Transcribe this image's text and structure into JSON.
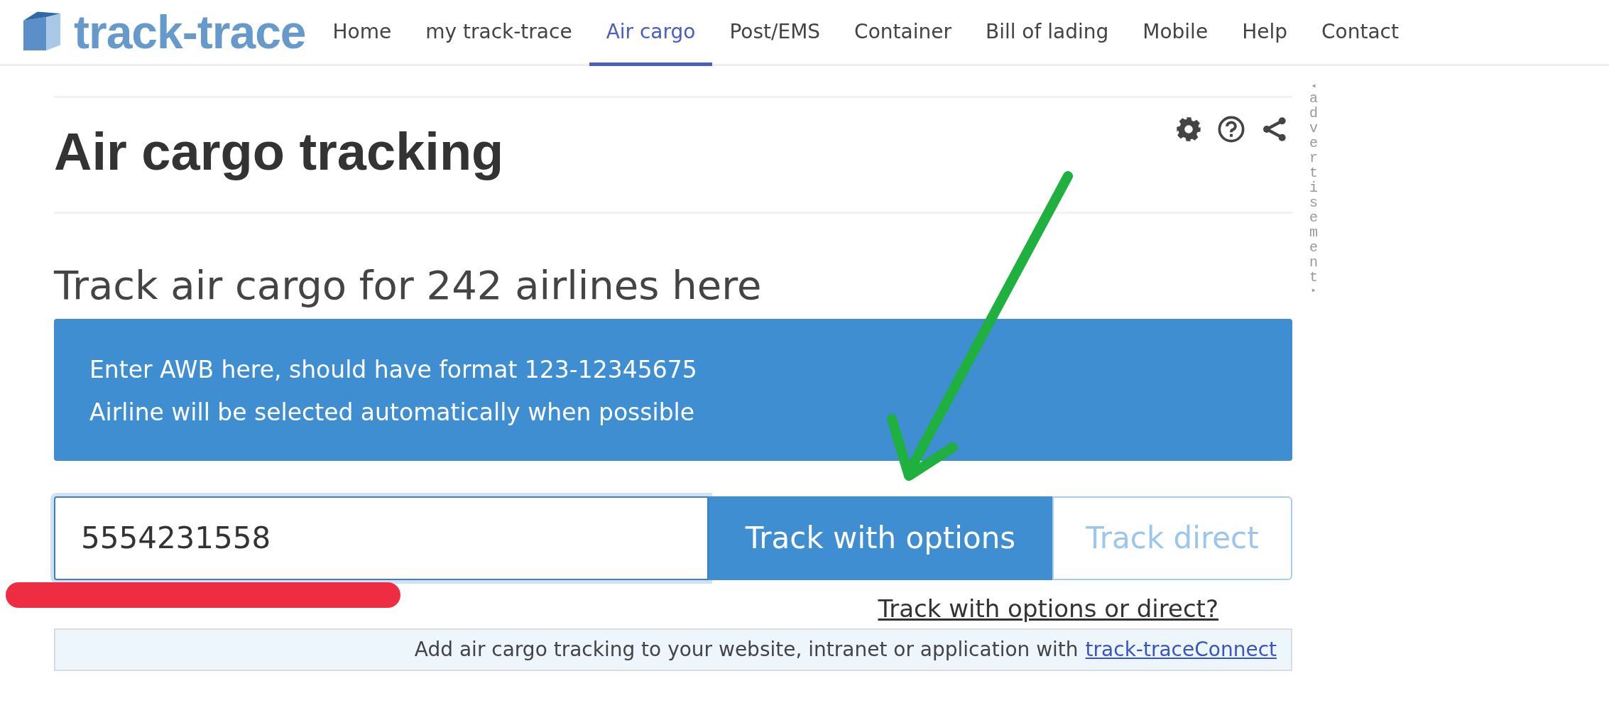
{
  "logo": {
    "text": "track-trace"
  },
  "nav": [
    {
      "label": "Home",
      "selected": false
    },
    {
      "label": "my track-trace",
      "selected": false
    },
    {
      "label": "Air cargo",
      "selected": true
    },
    {
      "label": "Post/EMS",
      "selected": false
    },
    {
      "label": "Container",
      "selected": false
    },
    {
      "label": "Bill of lading",
      "selected": false
    },
    {
      "label": "Mobile",
      "selected": false
    },
    {
      "label": "Help",
      "selected": false
    },
    {
      "label": "Contact",
      "selected": false
    }
  ],
  "title": "Air cargo tracking",
  "advertisement": {
    "start": "◂",
    "text": "advertisement",
    "end": "▸"
  },
  "subtitle": "Track air cargo for 242 airlines here",
  "info": [
    "Enter AWB here, should have format 123-12345675",
    "Airline will be selected automatically when possible"
  ],
  "awb_field": {
    "value": "5554231558"
  },
  "buttons": [
    {
      "label": "Track with options",
      "kind": "primary"
    },
    {
      "label": "Track direct",
      "kind": "outline"
    }
  ],
  "help_link": "Track with options or direct?",
  "footer": {
    "text": "Add air cargo tracking to your website, intranet or application with",
    "link": "track-traceConnect"
  }
}
